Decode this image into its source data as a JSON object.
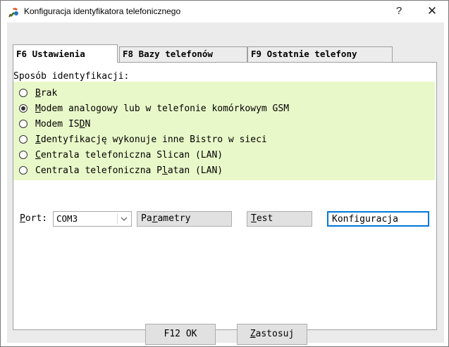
{
  "window": {
    "title": "Konfiguracja identyfikatora telefonicznego",
    "help_label": "?",
    "close_label": "✕"
  },
  "tabs": [
    {
      "label": "F6 Ustawienia",
      "active": true
    },
    {
      "label": "F8 Bazy telefonów",
      "active": false
    },
    {
      "label": "F9 Ostatnie telefony",
      "active": false
    }
  ],
  "identification": {
    "label": "Sposób identyfikacji:",
    "options": [
      {
        "pre": "",
        "u": "B",
        "post": "rak",
        "checked": false
      },
      {
        "pre": "",
        "u": "M",
        "post": "odem analogowy lub w telefonie komórkowym GSM",
        "checked": true
      },
      {
        "pre": "Modem IS",
        "u": "D",
        "post": "N",
        "checked": false
      },
      {
        "pre": "",
        "u": "I",
        "post": "dentyfikację wykonuje inne Bistro w sieci",
        "checked": false
      },
      {
        "pre": "",
        "u": "C",
        "post": "entrala telefoniczna Slican (LAN)",
        "checked": false
      },
      {
        "pre": "Centrala telefoniczna P",
        "u": "l",
        "post": "atan (LAN)",
        "checked": false
      }
    ]
  },
  "port": {
    "label_u": "P",
    "label_rest": "ort:",
    "value": "COM3"
  },
  "buttons": {
    "parametry": {
      "pre": "Pa",
      "u": "r",
      "post": "ametry"
    },
    "test": {
      "pre": "",
      "u": "T",
      "post": "est"
    },
    "konfiguracja": {
      "label": "Konfiguracja"
    },
    "ok": {
      "label": "F12 OK"
    },
    "zastosuj": {
      "pre": "",
      "u": "Z",
      "post": "astosuj"
    }
  },
  "colors": {
    "radio_group_bg": "#e9f8c9",
    "dialog_bg": "#ebebeb",
    "focus_border": "#0078d7"
  },
  "icons": {
    "app": "gear-phone-icon",
    "dropdown": "chevron-down-icon"
  }
}
